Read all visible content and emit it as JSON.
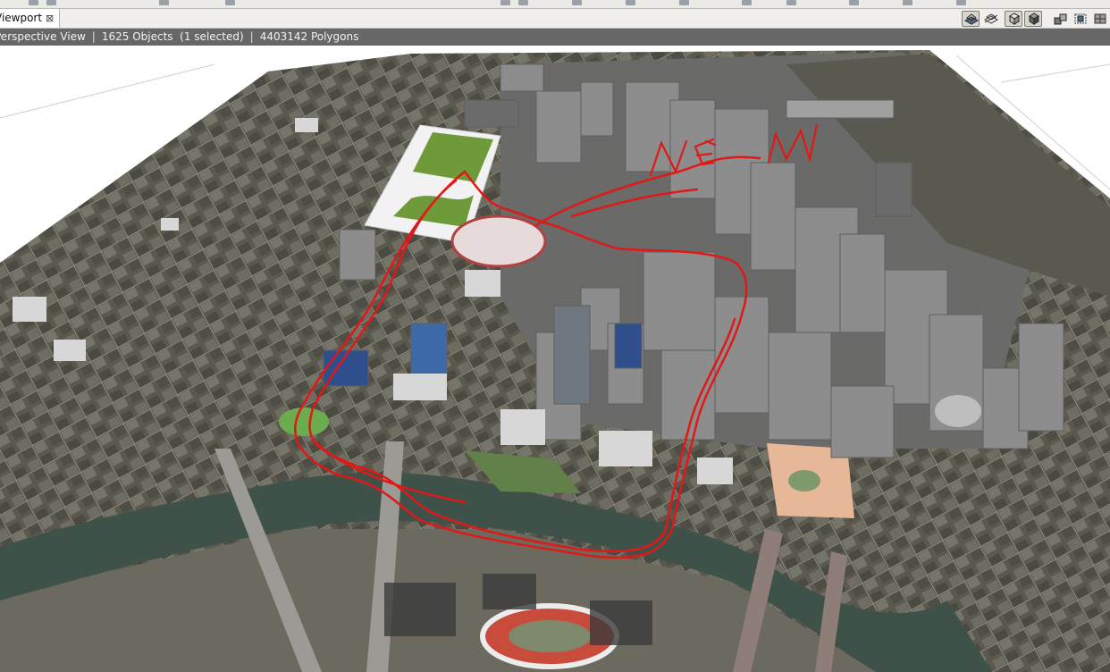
{
  "tab": {
    "title": "Viewport",
    "close": "⊠"
  },
  "status": {
    "view": "Perspective View",
    "objects": "1625 Objects",
    "selected": "(1 selected)",
    "polygons": "4403142 Polygons"
  },
  "toolbar": {
    "view_buttons": [
      {
        "name": "wireframe-mode-icon",
        "active": true
      },
      {
        "name": "hidden-line-icon",
        "active": false
      },
      {
        "name": "shaded-mode-icon",
        "active": true
      },
      {
        "name": "textured-mode-icon",
        "active": true
      },
      {
        "name": "lighting-icon",
        "active": false
      },
      {
        "name": "selection-box-icon",
        "active": false
      },
      {
        "name": "grid-snap-icon",
        "active": false
      }
    ]
  },
  "annotation": {
    "text": "NEW",
    "color": "#e01818"
  },
  "colors": {
    "ground": "#5c5a4e",
    "river": "#3e5249",
    "building": "#8d8d8d",
    "sketch": "#e01818"
  }
}
